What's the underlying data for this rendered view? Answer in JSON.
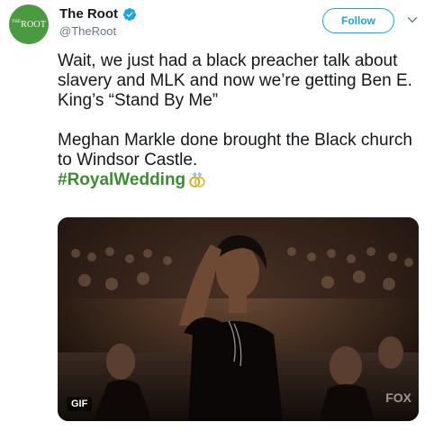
{
  "author": {
    "display_name": "The Root",
    "handle": "@TheRoot",
    "avatar_logo_small": "THE",
    "avatar_logo_big": "ROOT",
    "verified": true,
    "brand_color": "#4a9a3f"
  },
  "actions": {
    "follow_label": "Follow",
    "menu_icon": "chevron-down-icon"
  },
  "tweet": {
    "paragraph1": "Wait, we just had a black preacher talk about slavery and MLK and now we’re getting Ben E. King’s “Stand By Me”",
    "paragraph2": "Meghan Markle done brought the Black church to Windsor Castle.",
    "hashtag": "#RoyalWedding",
    "hashtag_emoji": "rings-icon",
    "hashtag_color": "#3c8d2f"
  },
  "media": {
    "type_badge": "GIF",
    "watermark": "FOX"
  },
  "colors": {
    "accent": "#1da1f2",
    "secondary_text": "#657786"
  }
}
